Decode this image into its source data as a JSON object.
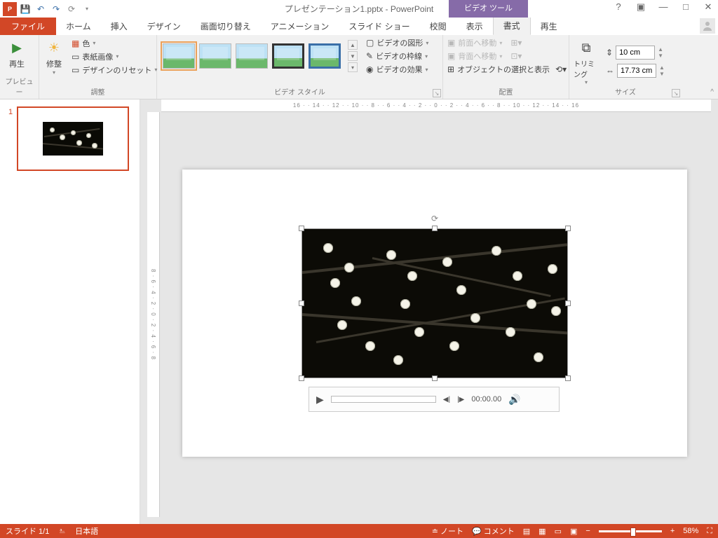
{
  "title": "プレゼンテーション1.pptx - PowerPoint",
  "tool_tab": "ビデオ ツール",
  "tabs": {
    "file": "ファイル",
    "home": "ホーム",
    "insert": "挿入",
    "design": "デザイン",
    "transition": "画面切り替え",
    "animation": "アニメーション",
    "slideshow": "スライド ショー",
    "review": "校閲",
    "view": "表示",
    "format": "書式",
    "playback": "再生"
  },
  "ribbon": {
    "preview": {
      "play": "再生",
      "label": "プレビュー"
    },
    "adjust": {
      "corrections": "修整",
      "color": "色",
      "poster": "表紙画像",
      "reset": "デザインのリセット",
      "label": "調整"
    },
    "styles": {
      "shape": "ビデオの図形",
      "border": "ビデオの枠線",
      "effects": "ビデオの効果",
      "label": "ビデオ スタイル"
    },
    "arrange": {
      "forward": "前面へ移動",
      "backward": "背面へ移動",
      "selection": "オブジェクトの選択と表示",
      "label": "配置"
    },
    "size": {
      "trim": "トリミング",
      "height": "10 cm",
      "width": "17.73 cm",
      "label": "サイズ"
    }
  },
  "slide": {
    "num": "1"
  },
  "player": {
    "time": "00:00.00"
  },
  "status": {
    "slide": "スライド 1/1",
    "lang": "日本語",
    "notes": "ノート",
    "comments": "コメント",
    "zoom": "58%"
  },
  "ruler_h": "16 · · 14 · · 12 · · 10 · · 8 · · 6 · · 4 · · 2 · · 0 · · 2 · · 4 · · 6 · · 8 · · 10 · · 12 · · 14 · · 16",
  "ruler_v": "8 · 6 · 4 · 2 · 0 · 2 · 4 · 6 · 8"
}
